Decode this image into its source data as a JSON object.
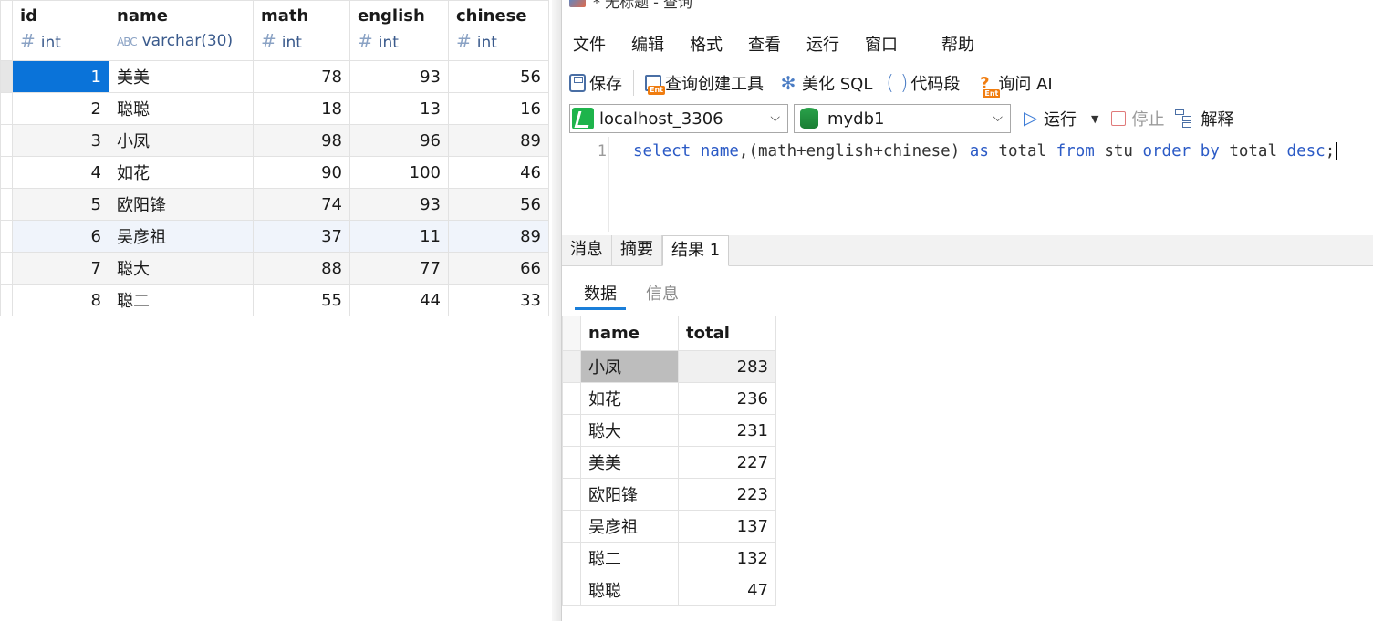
{
  "left_table": {
    "columns": [
      {
        "name": "id",
        "type": "int",
        "type_icon": "number-icon"
      },
      {
        "name": "name",
        "type": "varchar(30)",
        "type_icon": "text-abc-icon"
      },
      {
        "name": "math",
        "type": "int",
        "type_icon": "number-icon"
      },
      {
        "name": "english",
        "type": "int",
        "type_icon": "number-icon"
      },
      {
        "name": "chinese",
        "type": "int",
        "type_icon": "number-icon"
      }
    ],
    "rows": [
      {
        "id": "1",
        "name": "美美",
        "math": "78",
        "english": "93",
        "chinese": "56"
      },
      {
        "id": "2",
        "name": "聪聪",
        "math": "18",
        "english": "13",
        "chinese": "16"
      },
      {
        "id": "3",
        "name": "小凤",
        "math": "98",
        "english": "96",
        "chinese": "89"
      },
      {
        "id": "4",
        "name": "如花",
        "math": "90",
        "english": "100",
        "chinese": "46"
      },
      {
        "id": "5",
        "name": "欧阳锋",
        "math": "74",
        "english": "93",
        "chinese": "56"
      },
      {
        "id": "6",
        "name": "吴彦祖",
        "math": "37",
        "english": "11",
        "chinese": "89"
      },
      {
        "id": "7",
        "name": "聪大",
        "math": "88",
        "english": "77",
        "chinese": "66"
      },
      {
        "id": "8",
        "name": "聪二",
        "math": "55",
        "english": "44",
        "chinese": "33"
      }
    ]
  },
  "query_window": {
    "title": "* 无标题 - 查询",
    "menu": [
      "文件",
      "编辑",
      "格式",
      "查看",
      "运行",
      "窗口",
      "帮助"
    ],
    "toolbar": {
      "save": "保存",
      "query_builder": "查询创建工具",
      "beautify": "美化 SQL",
      "snippet": "代码段",
      "ask_ai": "询问 AI",
      "ent_badge": "Ent"
    },
    "connection": "localhost_3306",
    "database": "mydb1",
    "run": "运行",
    "stop": "停止",
    "explain": "解释",
    "editor": {
      "line_number": "1",
      "tokens": [
        {
          "t": "select",
          "kw": true
        },
        {
          "t": " ",
          "kw": false
        },
        {
          "t": "name",
          "kw": true
        },
        {
          "t": ",(math+english+chinese) ",
          "kw": false
        },
        {
          "t": "as",
          "kw": true
        },
        {
          "t": " total ",
          "kw": false
        },
        {
          "t": "from",
          "kw": true
        },
        {
          "t": " stu ",
          "kw": false
        },
        {
          "t": "order by",
          "kw": true
        },
        {
          "t": " total ",
          "kw": false
        },
        {
          "t": "desc",
          "kw": true
        },
        {
          "t": ";",
          "kw": false
        }
      ]
    },
    "result_tabs": [
      "消息",
      "摘要",
      "结果 1"
    ],
    "sub_tabs": [
      "数据",
      "信息"
    ],
    "result": {
      "columns": [
        "name",
        "total"
      ],
      "rows": [
        {
          "name": "小凤",
          "total": "283"
        },
        {
          "name": "如花",
          "total": "236"
        },
        {
          "name": "聪大",
          "total": "231"
        },
        {
          "name": "美美",
          "total": "227"
        },
        {
          "name": "欧阳锋",
          "total": "223"
        },
        {
          "name": "吴彦祖",
          "total": "137"
        },
        {
          "name": "聪二",
          "total": "132"
        },
        {
          "name": "聪聪",
          "total": "47"
        }
      ]
    }
  },
  "colors": {
    "selection": "#0a73d9",
    "keyword": "#2c5bc6",
    "tab_underline": "#1a7ed9",
    "ent_badge": "#f07d10",
    "connection_icon": "#1db44b"
  }
}
